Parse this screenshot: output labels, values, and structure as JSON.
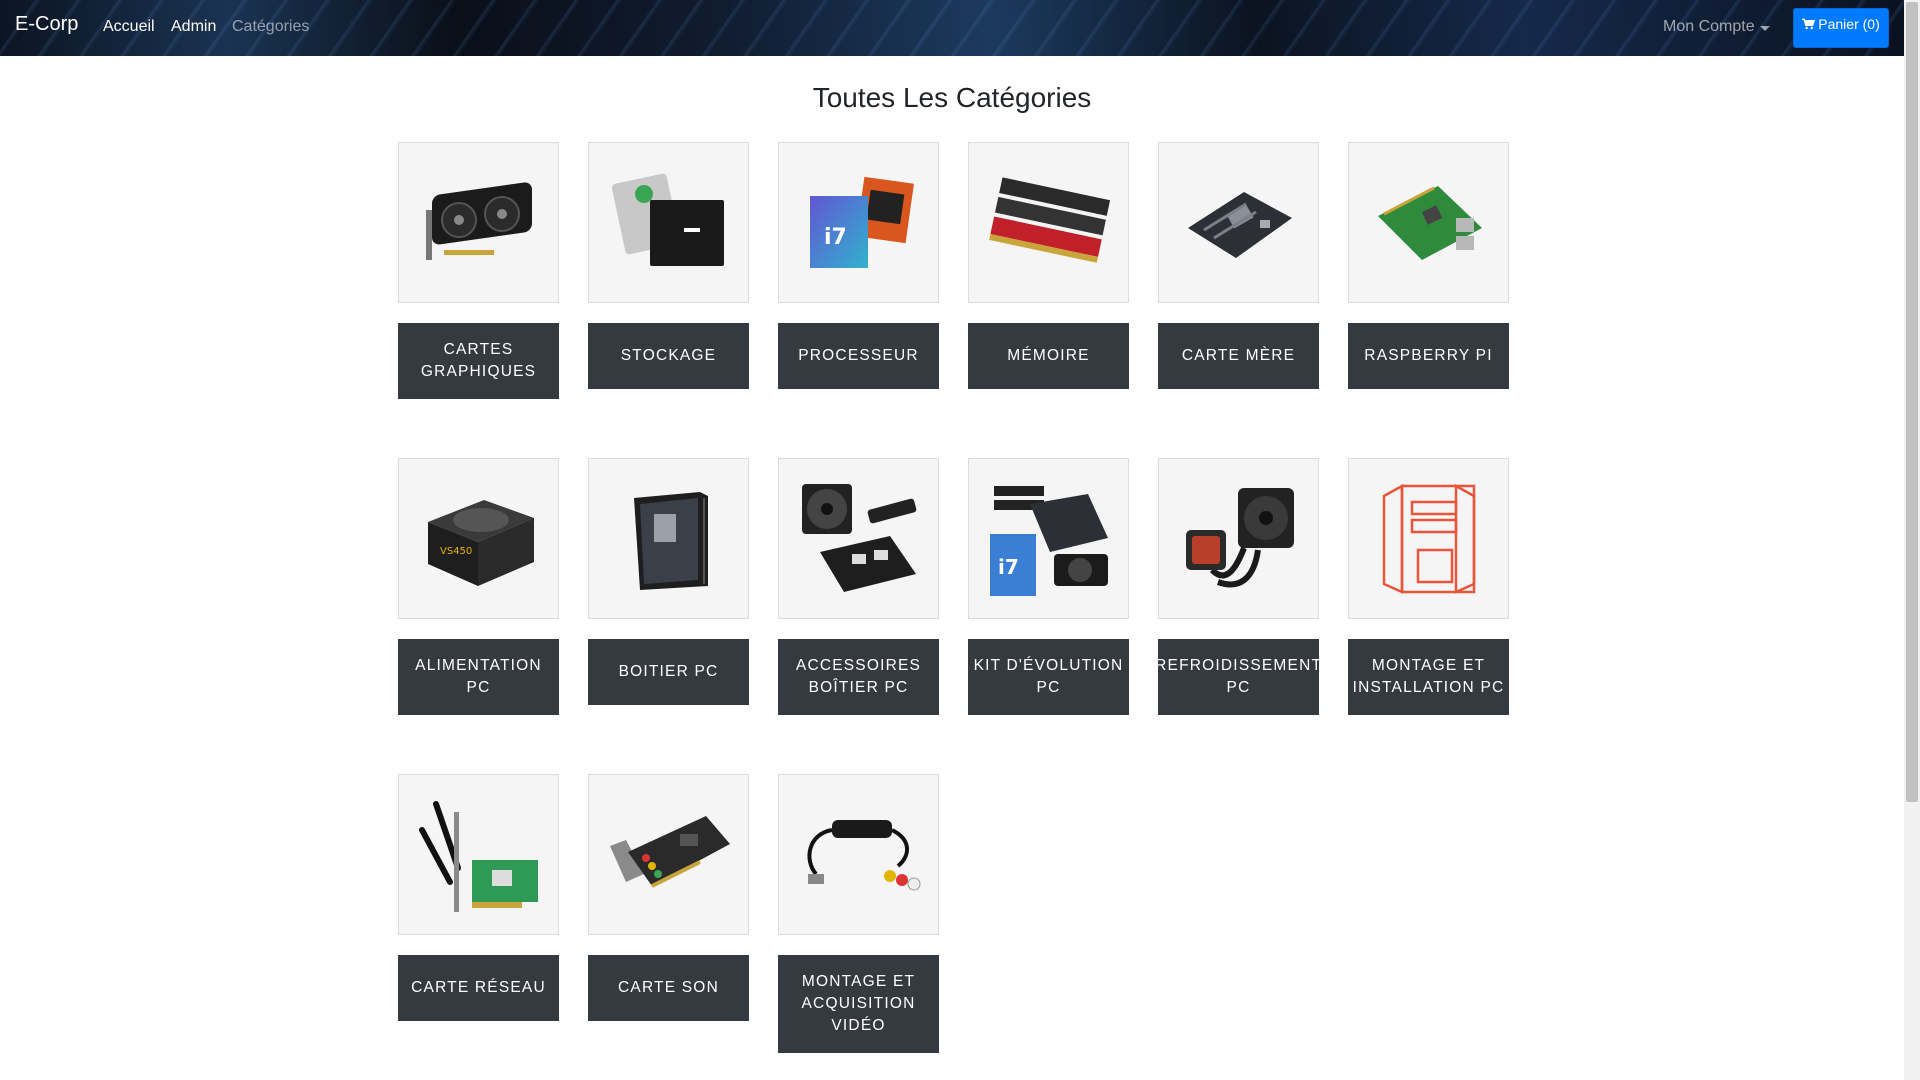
{
  "navbar": {
    "brand": "E-Corp",
    "links": [
      "Accueil",
      "Admin",
      "Catégories"
    ],
    "account_label": "Mon Compte",
    "cart_label": "Panier (0)"
  },
  "page": {
    "title": "Toutes Les Catégories"
  },
  "categories": [
    {
      "label": "CARTES GRAPHIQUES",
      "icon": "graphics-card-icon"
    },
    {
      "label": "STOCKAGE",
      "icon": "storage-drive-icon"
    },
    {
      "label": "PROCESSEUR",
      "icon": "processor-box-icon"
    },
    {
      "label": "MÉMOIRE",
      "icon": "memory-ram-icon"
    },
    {
      "label": "CARTE MÈRE",
      "icon": "motherboard-icon"
    },
    {
      "label": "RASPBERRY PI",
      "icon": "raspberry-pi-icon"
    },
    {
      "label": "ALIMENTATION PC",
      "icon": "power-supply-icon"
    },
    {
      "label": "BOITIER PC",
      "icon": "pc-case-icon"
    },
    {
      "label": "ACCESSOIRES BOÎTIER PC",
      "icon": "case-accessories-icon"
    },
    {
      "label": "KIT D'ÉVOLUTION PC",
      "icon": "upgrade-kit-icon"
    },
    {
      "label": "REFROIDISSEMENT PC",
      "icon": "water-cooling-icon"
    },
    {
      "label": "MONTAGE ET INSTALLATION PC",
      "icon": "assembly-outline-icon"
    },
    {
      "label": "CARTE RÉSEAU",
      "icon": "network-card-icon"
    },
    {
      "label": "CARTE SON",
      "icon": "sound-card-icon"
    },
    {
      "label": "MONTAGE ET ACQUISITION VIDÉO",
      "icon": "video-capture-icon"
    }
  ],
  "colors": {
    "navbar": "#0b1422",
    "cart_button": "#007bff",
    "category_button": "#343a40",
    "thumbnail_bg": "#f5f5f5",
    "accent_outline": "#e8553a"
  }
}
